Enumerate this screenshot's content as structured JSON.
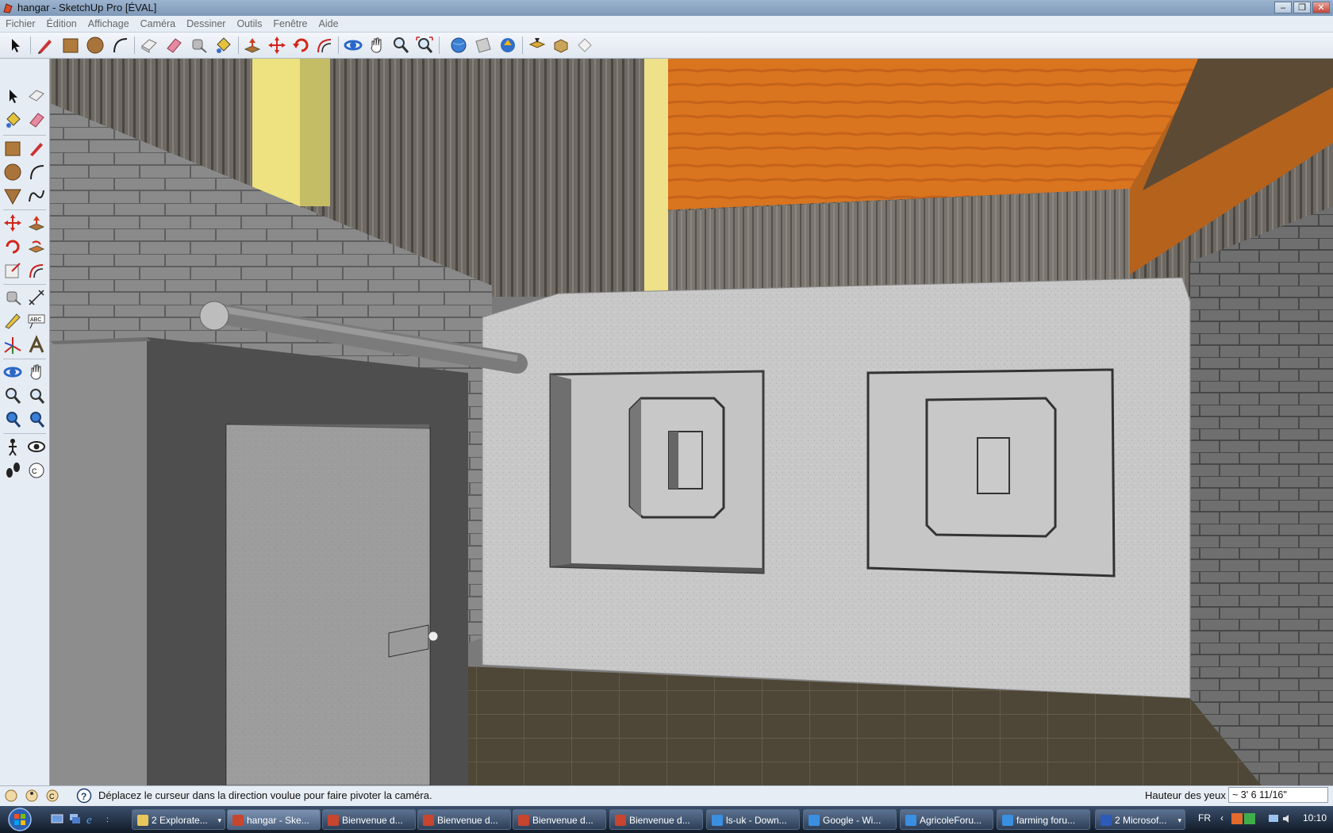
{
  "window": {
    "title": "hangar - SketchUp Pro [ÉVAL]",
    "buttons": {
      "minimize": "–",
      "maximize": "❐",
      "close": "✕"
    }
  },
  "menu": {
    "items": [
      "Fichier",
      "Édition",
      "Affichage",
      "Caméra",
      "Dessiner",
      "Outils",
      "Fenêtre",
      "Aide"
    ]
  },
  "toolbar": {
    "tools": [
      "select-icon",
      "pencil-icon",
      "rectangle-icon",
      "circle-icon",
      "arc-icon",
      "make-component-icon",
      "eraser-icon",
      "tape-measure-icon",
      "paint-bucket-icon",
      "push-pull-icon",
      "move-icon",
      "rotate-icon",
      "offset-icon",
      "orbit-icon",
      "pan-icon",
      "zoom-icon",
      "zoom-extents-icon",
      "get-models-icon",
      "share-model-icon",
      "get-photo-texture-icon",
      "share-component-icon",
      "components-icon",
      "preview-icon"
    ]
  },
  "left_toolbar": {
    "tools": [
      "select-icon",
      "make-component-icon",
      "paint-bucket-icon",
      "eraser-icon",
      "rectangle-icon",
      "line-icon",
      "circle-icon",
      "arc-icon",
      "polygon-icon",
      "freehand-icon",
      "move-icon",
      "push-pull-icon",
      "rotate-icon",
      "follow-me-icon",
      "scale-icon",
      "offset-icon",
      "tape-measure-icon",
      "dimension-icon",
      "protractor-icon",
      "text-icon",
      "axes-icon",
      "3d-text-icon",
      "orbit-icon",
      "pan-icon",
      "zoom-icon",
      "zoom-window-icon",
      "previous-view-icon",
      "next-view-icon",
      "position-camera-icon",
      "look-around-icon",
      "walk-icon",
      "section-plane-icon"
    ]
  },
  "status": {
    "hint": "Déplacez le curseur dans la direction voulue pour faire pivoter la caméra.",
    "measure_label": "Hauteur des yeux",
    "measure_value": "~ 3' 6 11/16\""
  },
  "taskbar": {
    "tasks": [
      {
        "label": "2 Explorate...",
        "icon": "folder-icon",
        "color": "#e8c75a"
      },
      {
        "label": "hangar - Ske...",
        "icon": "sketchup-icon",
        "color": "#c8452f"
      },
      {
        "label": "Bienvenue d...",
        "icon": "sketchup-icon",
        "color": "#c8452f"
      },
      {
        "label": "Bienvenue d...",
        "icon": "sketchup-icon",
        "color": "#c8452f"
      },
      {
        "label": "Bienvenue d...",
        "icon": "sketchup-icon",
        "color": "#c8452f"
      },
      {
        "label": "Bienvenue d...",
        "icon": "sketchup-icon",
        "color": "#c8452f"
      },
      {
        "label": "ls-uk - Down...",
        "icon": "ie-icon",
        "color": "#3b8fe0"
      },
      {
        "label": "Google - Wi...",
        "icon": "ie-icon",
        "color": "#3b8fe0"
      },
      {
        "label": "AgricoleForu...",
        "icon": "ie-icon",
        "color": "#3b8fe0"
      },
      {
        "label": "farming foru...",
        "icon": "ie-icon",
        "color": "#3b8fe0"
      },
      {
        "label": "2 Microsof...",
        "icon": "word-icon",
        "color": "#2c5bb8"
      }
    ],
    "language": "FR",
    "clock": "10:10"
  }
}
